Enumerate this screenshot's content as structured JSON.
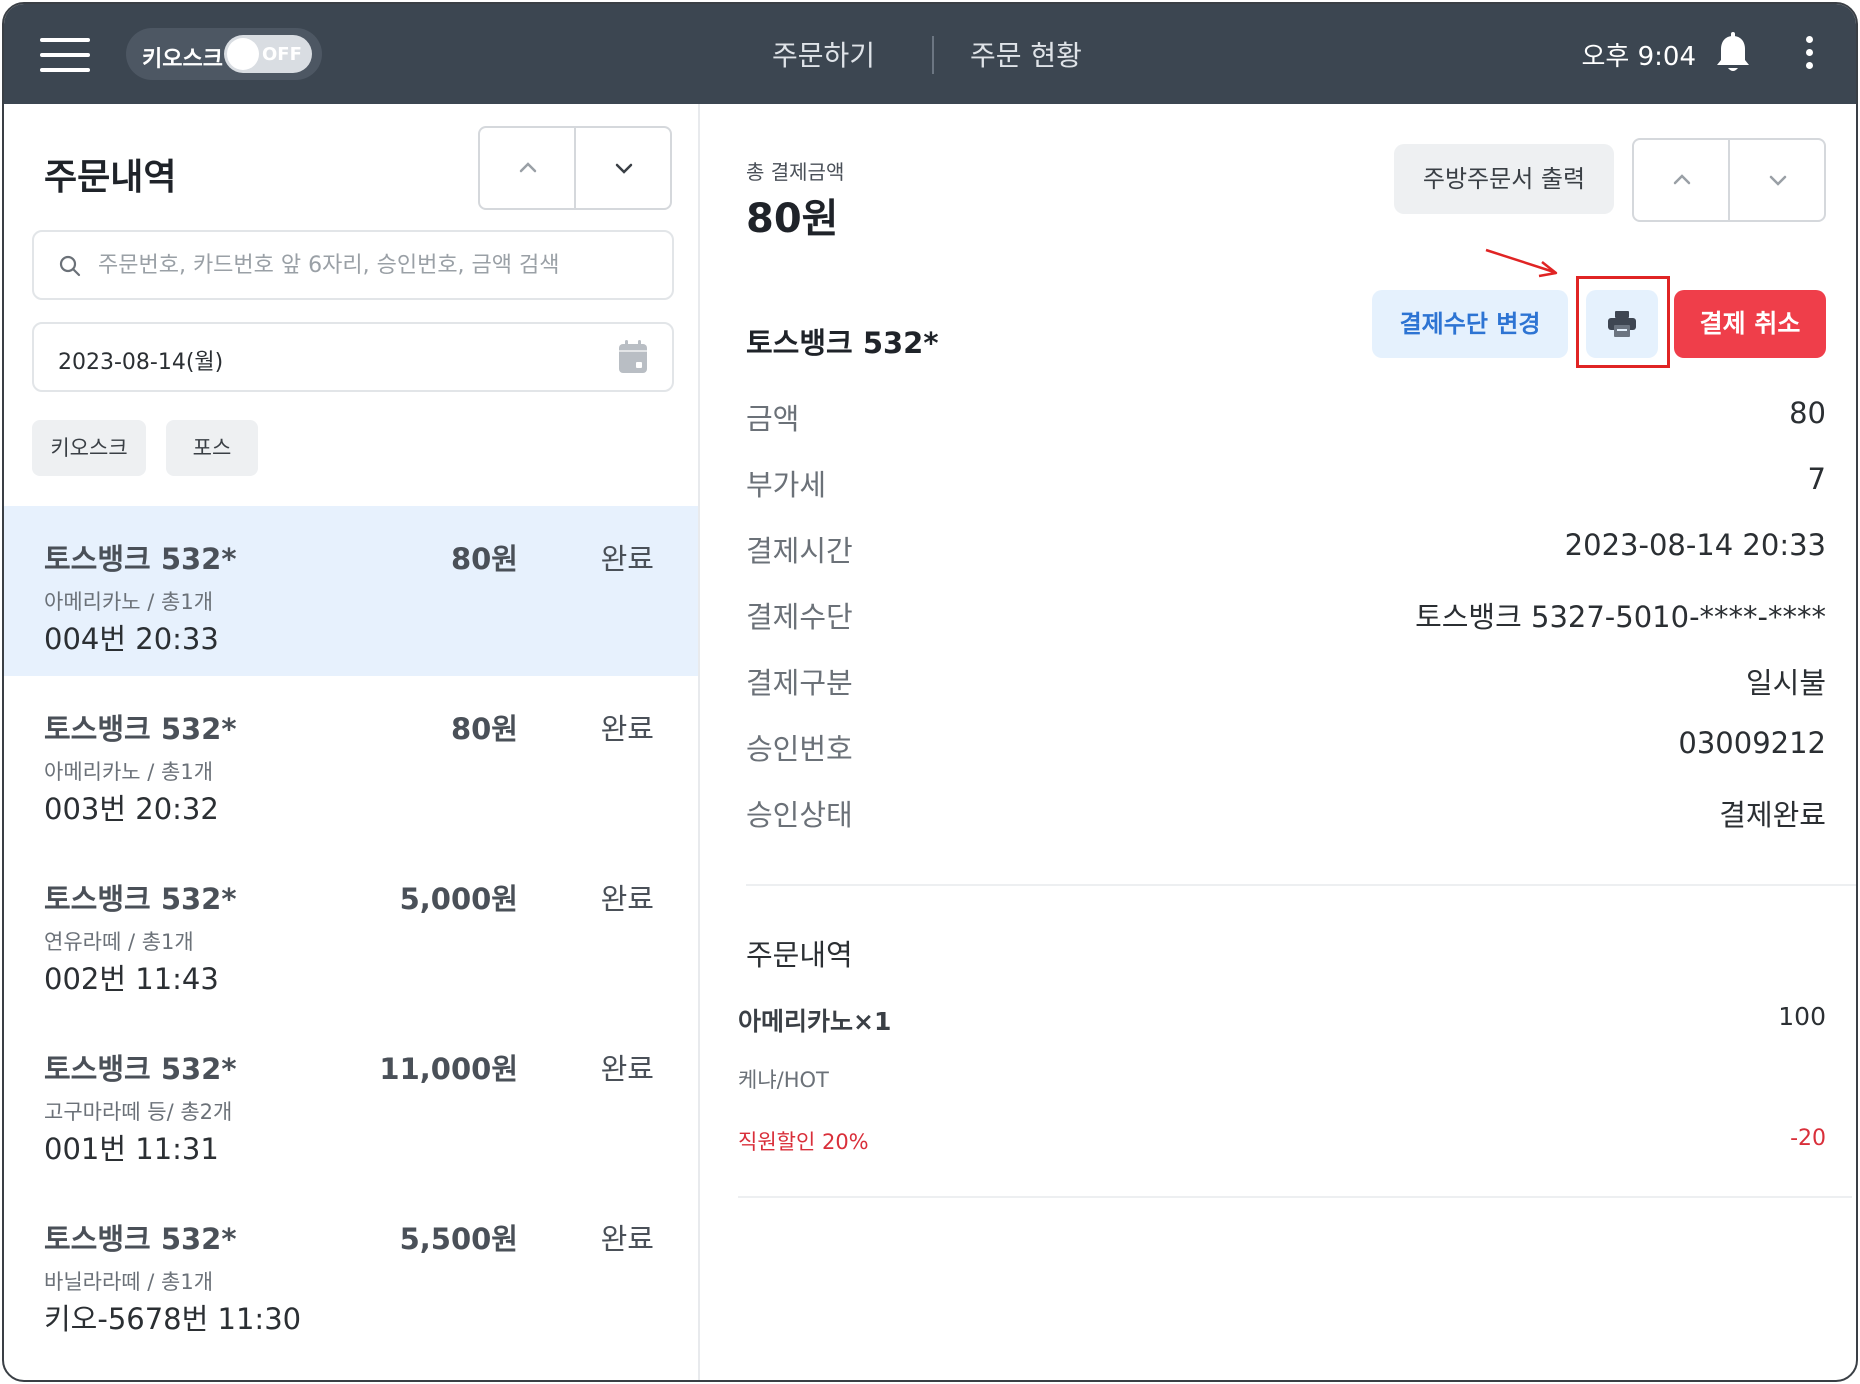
{
  "header": {
    "kiosk_label": "키오스크",
    "kiosk_toggle": "OFF",
    "tabs": [
      {
        "label": "주문하기"
      },
      {
        "label": "주문 현황"
      }
    ],
    "time": "오후 9:04"
  },
  "left": {
    "title": "주문내역",
    "search_placeholder": "주문번호, 카드번호 앞 6자리, 승인번호, 금액 검색",
    "date": "2023-08-14(월)",
    "filters": [
      "키오스크",
      "포스"
    ],
    "orders": [
      {
        "name": "토스뱅크 532*",
        "amount": "80원",
        "status": "완료",
        "items": "아메리카노 / 총1개",
        "number": "004번 20:33",
        "active": true
      },
      {
        "name": "토스뱅크 532*",
        "amount": "80원",
        "status": "완료",
        "items": "아메리카노 / 총1개",
        "number": "003번 20:32",
        "active": false
      },
      {
        "name": "토스뱅크 532*",
        "amount": "5,000원",
        "status": "완료",
        "items": "연유라떼 / 총1개",
        "number": "002번 11:43",
        "active": false
      },
      {
        "name": "토스뱅크 532*",
        "amount": "11,000원",
        "status": "완료",
        "items": "고구마라떼 등/ 총2개",
        "number": "001번 11:31",
        "active": false
      },
      {
        "name": "토스뱅크 532*",
        "amount": "5,500원",
        "status": "완료",
        "items": "바닐라라떼 / 총1개",
        "number": "키오-5678번 11:30",
        "active": false
      }
    ]
  },
  "right": {
    "total_label": "총 결제금액",
    "total_value": "80원",
    "kitchen_print_label": "주방주문서 출력",
    "card_name": "토스뱅크 532*",
    "change_payment_label": "결제수단 변경",
    "cancel_label": "결제 취소",
    "details": [
      {
        "label": "금액",
        "value": "80"
      },
      {
        "label": "부가세",
        "value": "7"
      },
      {
        "label": "결제시간",
        "value": "2023-08-14 20:33"
      },
      {
        "label": "결제수단",
        "value": "토스뱅크 5327-5010-****-****"
      },
      {
        "label": "결제구분",
        "value": "일시불"
      },
      {
        "label": "승인번호",
        "value": "03009212"
      },
      {
        "label": "승인상태",
        "value": "결제완료"
      }
    ],
    "order_section_title": "주문내역",
    "order_item": {
      "name": "아메리카노×1",
      "price": "100",
      "option": "케냐/HOT",
      "discount_label": "직원할인 20%",
      "discount_value": "-20"
    }
  },
  "colors": {
    "topbar": "#3c4651",
    "accent_blue": "#2d74d3",
    "cancel_red": "#ef3e4a",
    "active_row": "#e7f1fd",
    "highlight": "#e02424"
  },
  "icons": [
    "menu-icon",
    "bell-icon",
    "more-vertical-icon",
    "search-icon",
    "calendar-icon",
    "chevron-up-icon",
    "chevron-down-icon",
    "printer-icon"
  ]
}
